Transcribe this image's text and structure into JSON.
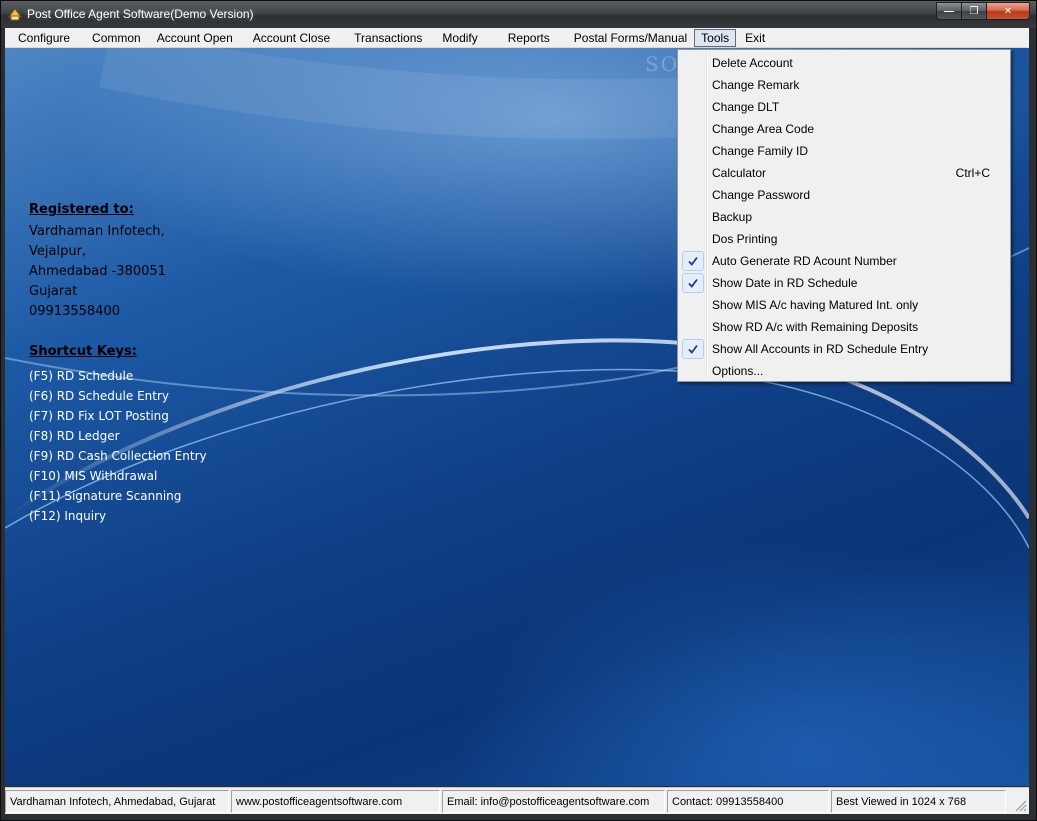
{
  "window": {
    "title": "Post Office Agent Software(Demo Version)",
    "controls": {
      "minimize": "—",
      "maximize": "❐",
      "close": "✕"
    }
  },
  "menubar": {
    "items": [
      "Configure",
      "Common",
      "Account Open",
      "Account Close",
      "Transactions",
      "Modify",
      "Reports",
      "Postal Forms/Manual",
      "Tools",
      "Exit"
    ],
    "active": "Tools"
  },
  "watermark": "SOFTP",
  "registered": {
    "heading": "Registered to:",
    "lines": [
      "Vardhaman Infotech,",
      "Vejalpur,",
      "Ahmedabad -380051",
      "Gujarat",
      "09913558400"
    ]
  },
  "shortcuts": {
    "heading": "Shortcut Keys:",
    "lines": [
      "(F5) RD Schedule",
      "(F6) RD Schedule Entry",
      "(F7) RD Fix LOT Posting",
      "(F8) RD Ledger",
      "(F9) RD Cash Collection Entry",
      "(F10) MIS Withdrawal",
      "(F11) Signature Scanning",
      "(F12) Inquiry"
    ]
  },
  "tools_menu": {
    "items": [
      {
        "label": "Delete Account",
        "checked": false
      },
      {
        "label": "Change Remark",
        "checked": false
      },
      {
        "label": "Change DLT",
        "checked": false
      },
      {
        "label": "Change Area Code",
        "checked": false
      },
      {
        "label": "Change Family ID",
        "checked": false
      },
      {
        "label": "Calculator",
        "shortcut": "Ctrl+C",
        "checked": false
      },
      {
        "label": "Change Password",
        "checked": false
      },
      {
        "label": "Backup",
        "checked": false
      },
      {
        "label": "Dos Printing",
        "checked": false
      },
      {
        "label": "Auto Generate RD Acount Number",
        "checked": true
      },
      {
        "label": "Show Date in RD Schedule",
        "checked": true
      },
      {
        "label": "Show MIS A/c having Matured Int. only",
        "checked": false
      },
      {
        "label": "Show RD A/c with Remaining Deposits",
        "checked": false
      },
      {
        "label": "Show All Accounts in RD Schedule Entry",
        "checked": true
      },
      {
        "label": "Options...",
        "checked": false
      }
    ]
  },
  "statusbar": {
    "company": "Vardhaman Infotech, Ahmedabad, Gujarat",
    "website": "www.postofficeagentsoftware.com",
    "email": "Email: info@postofficeagentsoftware.com",
    "contact": "Contact: 09913558400",
    "best_view": "Best Viewed in 1024 x 768"
  },
  "colors": {
    "menu_bg": "#f0f0f0",
    "check": "#1c3a8f",
    "desktop_blue": "#0f3f86"
  }
}
